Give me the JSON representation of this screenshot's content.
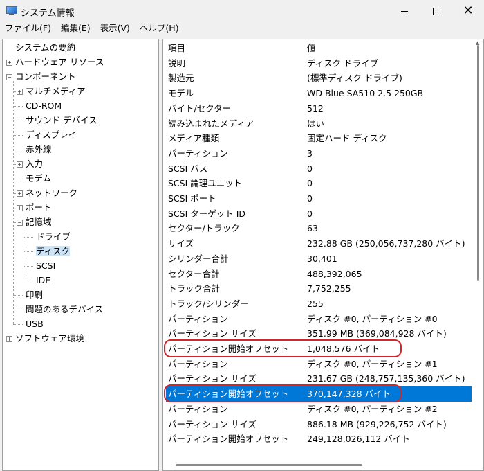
{
  "window": {
    "title": "システム情報",
    "icon": "system-info-icon"
  },
  "menu": [
    "ファイル(F)",
    "編集(E)",
    "表示(V)",
    "ヘルプ(H)"
  ],
  "tree": [
    {
      "label": "システムの要約",
      "level": 0,
      "expander": null
    },
    {
      "label": "ハードウェア リソース",
      "level": 0,
      "expander": "+"
    },
    {
      "label": "コンポーネント",
      "level": 0,
      "expander": "-"
    },
    {
      "label": "マルチメディア",
      "level": 1,
      "expander": "+"
    },
    {
      "label": "CD-ROM",
      "level": 1,
      "expander": null
    },
    {
      "label": "サウンド デバイス",
      "level": 1,
      "expander": null
    },
    {
      "label": "ディスプレイ",
      "level": 1,
      "expander": null
    },
    {
      "label": "赤外線",
      "level": 1,
      "expander": null
    },
    {
      "label": "入力",
      "level": 1,
      "expander": "+"
    },
    {
      "label": "モデム",
      "level": 1,
      "expander": null
    },
    {
      "label": "ネットワーク",
      "level": 1,
      "expander": "+"
    },
    {
      "label": "ポート",
      "level": 1,
      "expander": "+"
    },
    {
      "label": "記憶域",
      "level": 1,
      "expander": "-"
    },
    {
      "label": "ドライブ",
      "level": 2,
      "expander": null
    },
    {
      "label": "ディスク",
      "level": 2,
      "expander": null,
      "selected": true
    },
    {
      "label": "SCSI",
      "level": 2,
      "expander": null
    },
    {
      "label": "IDE",
      "level": 2,
      "expander": null
    },
    {
      "label": "印刷",
      "level": 1,
      "expander": null
    },
    {
      "label": "問題のあるデバイス",
      "level": 1,
      "expander": null
    },
    {
      "label": "USB",
      "level": 1,
      "expander": null
    },
    {
      "label": "ソフトウェア環境",
      "level": 0,
      "expander": "+"
    }
  ],
  "columns": [
    "項目",
    "値"
  ],
  "rows": [
    {
      "item": "説明",
      "value": "ディスク ドライブ"
    },
    {
      "item": "製造元",
      "value": "(標準ディスク ドライブ)"
    },
    {
      "item": "モデル",
      "value": "WD Blue SA510 2.5 250GB"
    },
    {
      "item": "バイト/セクター",
      "value": "512"
    },
    {
      "item": "読み込まれたメディア",
      "value": "はい"
    },
    {
      "item": "メディア種類",
      "value": "固定ハード ディスク"
    },
    {
      "item": "パーティション",
      "value": "3"
    },
    {
      "item": "SCSI バス",
      "value": "0"
    },
    {
      "item": "SCSI 論理ユニット",
      "value": "0"
    },
    {
      "item": "SCSI ポート",
      "value": "0"
    },
    {
      "item": "SCSI ターゲット ID",
      "value": "0"
    },
    {
      "item": "セクター/トラック",
      "value": "63"
    },
    {
      "item": "サイズ",
      "value": "232.88 GB (250,056,737,280 バイト)"
    },
    {
      "item": "シリンダー合計",
      "value": "30,401"
    },
    {
      "item": "セクター合計",
      "value": "488,392,065"
    },
    {
      "item": "トラック合計",
      "value": "7,752,255"
    },
    {
      "item": "トラック/シリンダー",
      "value": "255"
    },
    {
      "item": "パーティション",
      "value": "ディスク #0, パーティション #0"
    },
    {
      "item": "パーティション サイズ",
      "value": "351.99 MB (369,084,928 バイト)"
    },
    {
      "item": "パーティション開始オフセット",
      "value": "1,048,576 バイト",
      "annotated": true
    },
    {
      "item": "パーティション",
      "value": "ディスク #0, パーティション #1"
    },
    {
      "item": "パーティション サイズ",
      "value": "231.67 GB (248,757,135,360 バイト)"
    },
    {
      "item": "パーティション開始オフセット",
      "value": "370,147,328 バイト",
      "annotated": true,
      "selected": true
    },
    {
      "item": "パーティション",
      "value": "ディスク #0, パーティション #2"
    },
    {
      "item": "パーティション サイズ",
      "value": "886.18 MB (929,226,752 バイト)"
    },
    {
      "item": "パーティション開始オフセット",
      "value": "249,128,026,112 バイト"
    }
  ],
  "colors": {
    "selection": "#0078d7",
    "annotation": "#d3252b",
    "tree_selection": "#cce4f7"
  }
}
